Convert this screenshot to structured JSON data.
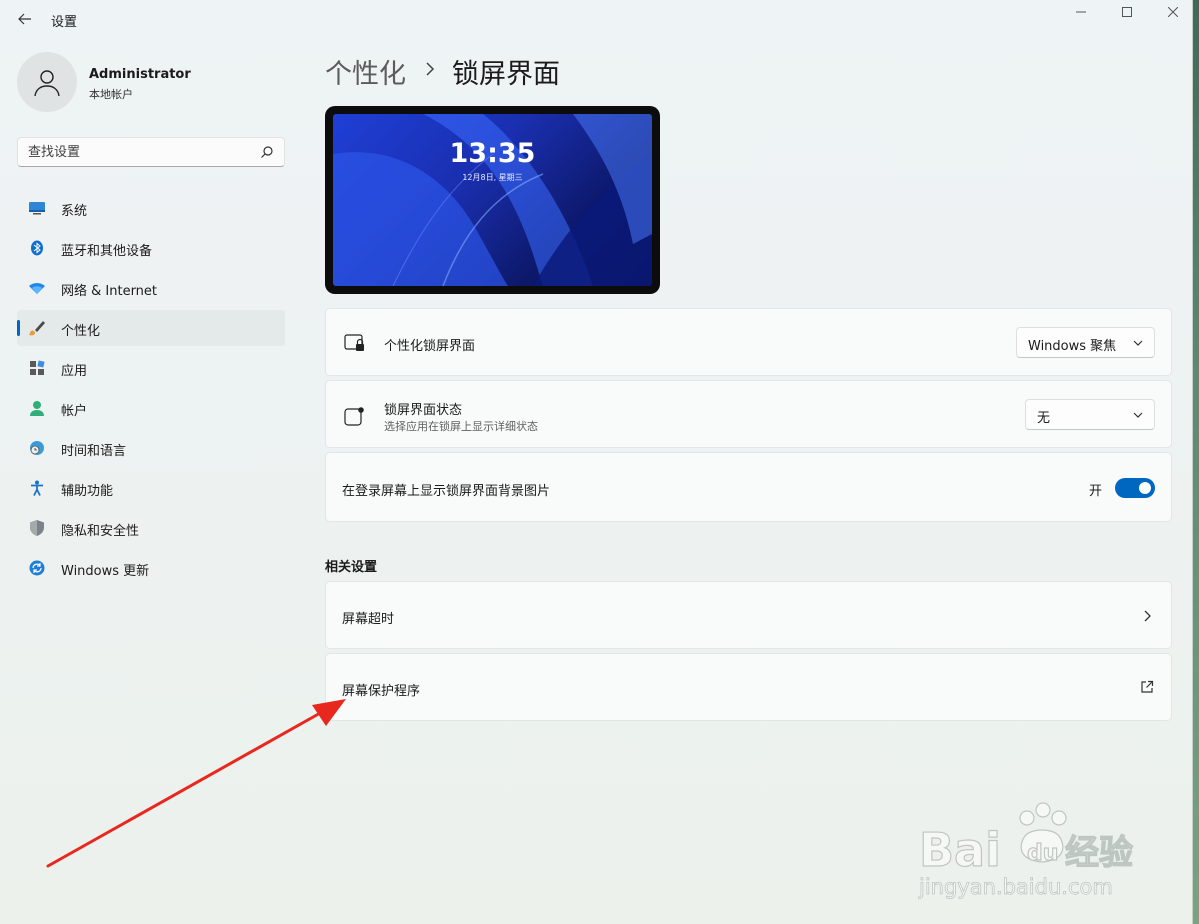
{
  "window": {
    "app_title": "设置",
    "controls": [
      "minimize-icon",
      "maximize-icon",
      "close-icon"
    ]
  },
  "user": {
    "name": "Administrator",
    "account_type": "本地帐户"
  },
  "search": {
    "placeholder": "查找设置"
  },
  "sidebar": {
    "items": [
      {
        "label": "系统",
        "icon": "monitor-icon"
      },
      {
        "label": "蓝牙和其他设备",
        "icon": "bluetooth-icon"
      },
      {
        "label": "网络 & Internet",
        "icon": "wifi-icon"
      },
      {
        "label": "个性化",
        "icon": "brush-icon",
        "active": true
      },
      {
        "label": "应用",
        "icon": "apps-icon"
      },
      {
        "label": "帐户",
        "icon": "person-icon"
      },
      {
        "label": "时间和语言",
        "icon": "globe-clock-icon"
      },
      {
        "label": "辅助功能",
        "icon": "accessibility-icon"
      },
      {
        "label": "隐私和安全性",
        "icon": "shield-icon"
      },
      {
        "label": "Windows 更新",
        "icon": "update-icon"
      }
    ]
  },
  "header": {
    "parent": "个性化",
    "current": "锁屏界面"
  },
  "preview": {
    "time": "13:35",
    "date": "12月8日, 星期三"
  },
  "settings": {
    "personalize": {
      "title": "个性化锁屏界面",
      "value": "Windows 聚焦"
    },
    "status": {
      "title": "锁屏界面状态",
      "subtitle": "选择应用在锁屏上显示详细状态",
      "value": "无"
    },
    "signin_background": {
      "title": "在登录屏幕上显示锁屏界面背景图片",
      "state_label": "开",
      "on": true
    }
  },
  "related": {
    "heading": "相关设置",
    "items": [
      {
        "label": "屏幕超时",
        "icon": "chevron-right-icon"
      },
      {
        "label": "屏幕保护程序",
        "icon": "external-link-icon"
      }
    ]
  },
  "colors": {
    "accent": "#0067c0",
    "annotation_arrow": "#e8281e"
  },
  "watermark": {
    "brand": "Baidu经验",
    "url": "jingyan.baidu.com"
  }
}
